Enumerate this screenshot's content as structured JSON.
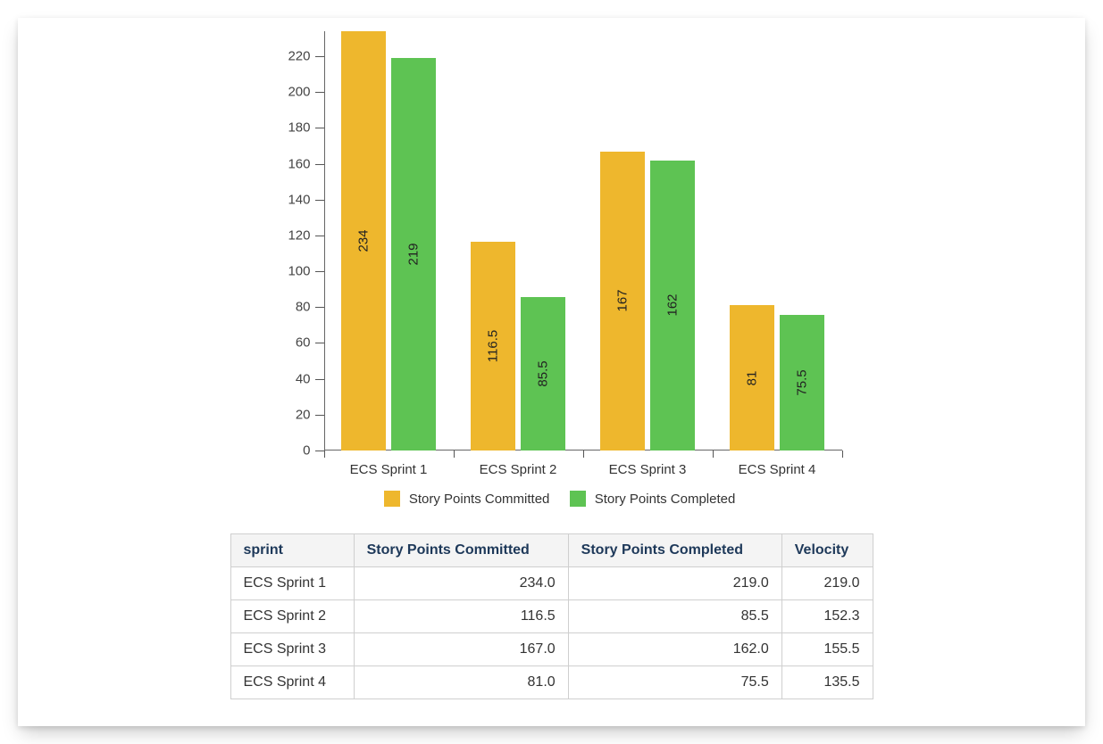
{
  "chart_data": {
    "type": "bar",
    "categories": [
      "ECS Sprint 1",
      "ECS Sprint 2",
      "ECS Sprint 3",
      "ECS Sprint 4"
    ],
    "series": [
      {
        "name": "Story Points Committed",
        "values": [
          234,
          116.5,
          167,
          81
        ],
        "color": "#eeb72d"
      },
      {
        "name": "Story Points Completed",
        "values": [
          219,
          85.5,
          162,
          75.5
        ],
        "color": "#5ec353"
      }
    ],
    "ylim": [
      0,
      234
    ],
    "yticks": [
      0,
      20,
      40,
      60,
      80,
      100,
      120,
      140,
      160,
      180,
      200,
      220
    ],
    "xlabel": "",
    "ylabel": "",
    "title": "",
    "legend_position": "bottom"
  },
  "legend": {
    "committed": "Story Points Committed",
    "completed": "Story Points Completed"
  },
  "table": {
    "headers": {
      "sprint": "sprint",
      "committed": "Story Points Committed",
      "completed": "Story Points Completed",
      "velocity": "Velocity"
    },
    "rows": [
      {
        "sprint": "ECS Sprint 1",
        "committed": "234.0",
        "completed": "219.0",
        "velocity": "219.0"
      },
      {
        "sprint": "ECS Sprint 2",
        "committed": "116.5",
        "completed": "85.5",
        "velocity": "152.3"
      },
      {
        "sprint": "ECS Sprint 3",
        "committed": "167.0",
        "completed": "162.0",
        "velocity": "155.5"
      },
      {
        "sprint": "ECS Sprint 4",
        "committed": "81.0",
        "completed": "75.5",
        "velocity": "135.5"
      }
    ]
  }
}
